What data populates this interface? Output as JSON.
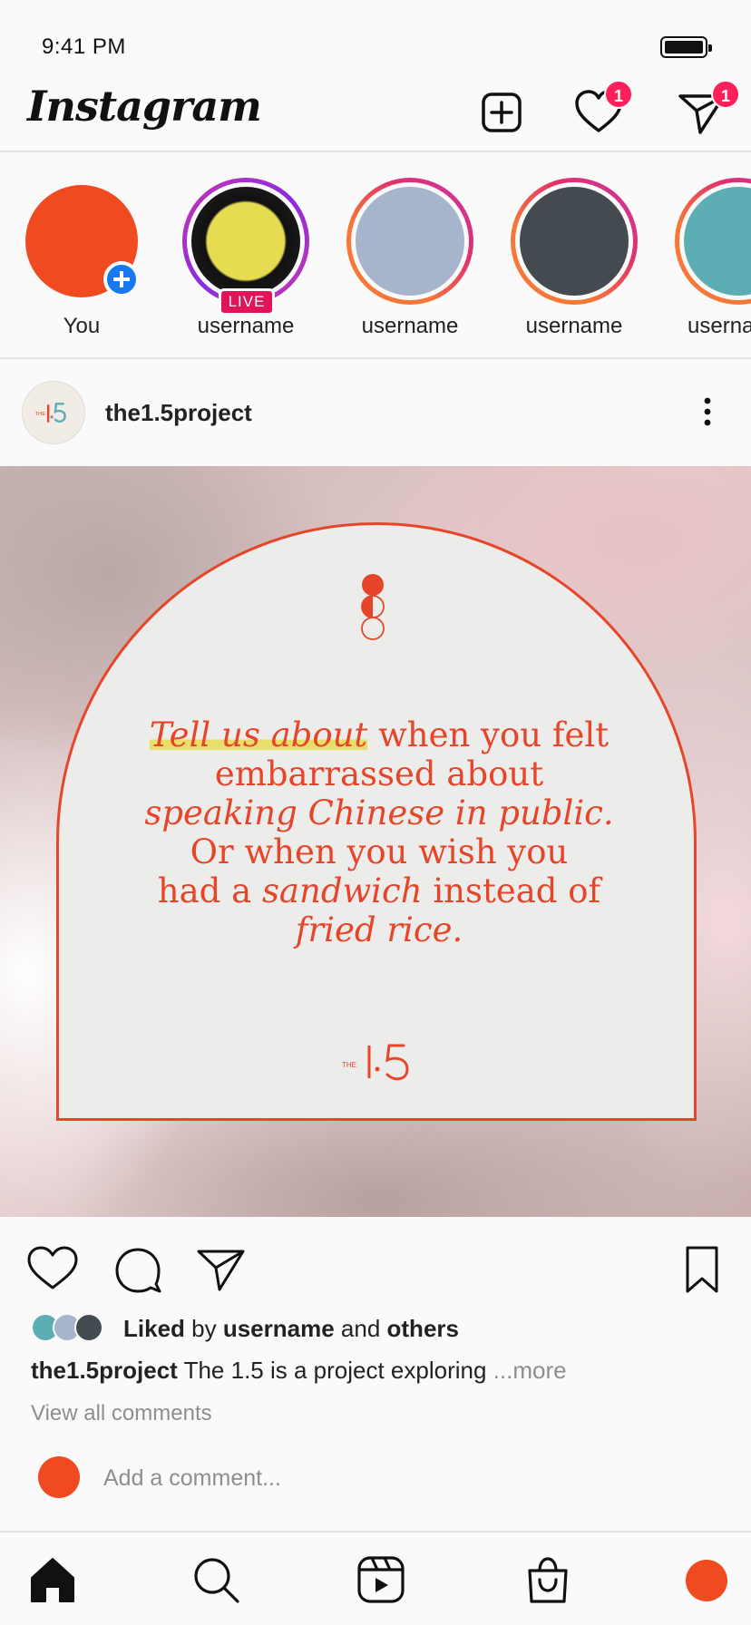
{
  "status_bar": {
    "time": "9:41 PM"
  },
  "top_nav": {
    "logo_text": "Instagram",
    "activity_badge": "1",
    "messages_badge": "1"
  },
  "stories": [
    {
      "label": "You",
      "color": "#f04a21",
      "ring": "none",
      "add": true
    },
    {
      "label": "username",
      "color": "#e5dc52",
      "ring": "live",
      "live_label": "LIVE"
    },
    {
      "label": "username",
      "color": "#a6b5cb",
      "ring": "gradient"
    },
    {
      "label": "username",
      "color": "#434a50",
      "ring": "gradient"
    },
    {
      "label": "userna",
      "color": "#5cadb4",
      "ring": "gradient"
    }
  ],
  "post": {
    "username": "the1.5project",
    "image": {
      "quote": {
        "l1_italic_highlight": "Tell us about",
        "l1_rest": " when you felt",
        "l2": "embarrassed about",
        "l3_italic": "speaking Chinese in public.",
        "l4": "Or when you wish you",
        "l5_a": "had a ",
        "l5_italic": "sandwich",
        "l5_b": " instead of",
        "l6_italic": "fried rice."
      },
      "logo_small": "THE",
      "logo_number": "1.5",
      "accent": "#e7452a"
    },
    "likes": {
      "prefix": "Liked",
      "by": " by ",
      "username": "username",
      "and": " and ",
      "others": "others",
      "avatar_colors": [
        "#5cadb4",
        "#a6b5cb",
        "#434a50"
      ]
    },
    "caption": {
      "username": "the1.5project",
      "text": " The 1.5 is a project exploring ",
      "more": "...more"
    },
    "view_comments": "View all comments",
    "add_comment_placeholder": "Add a comment..."
  }
}
